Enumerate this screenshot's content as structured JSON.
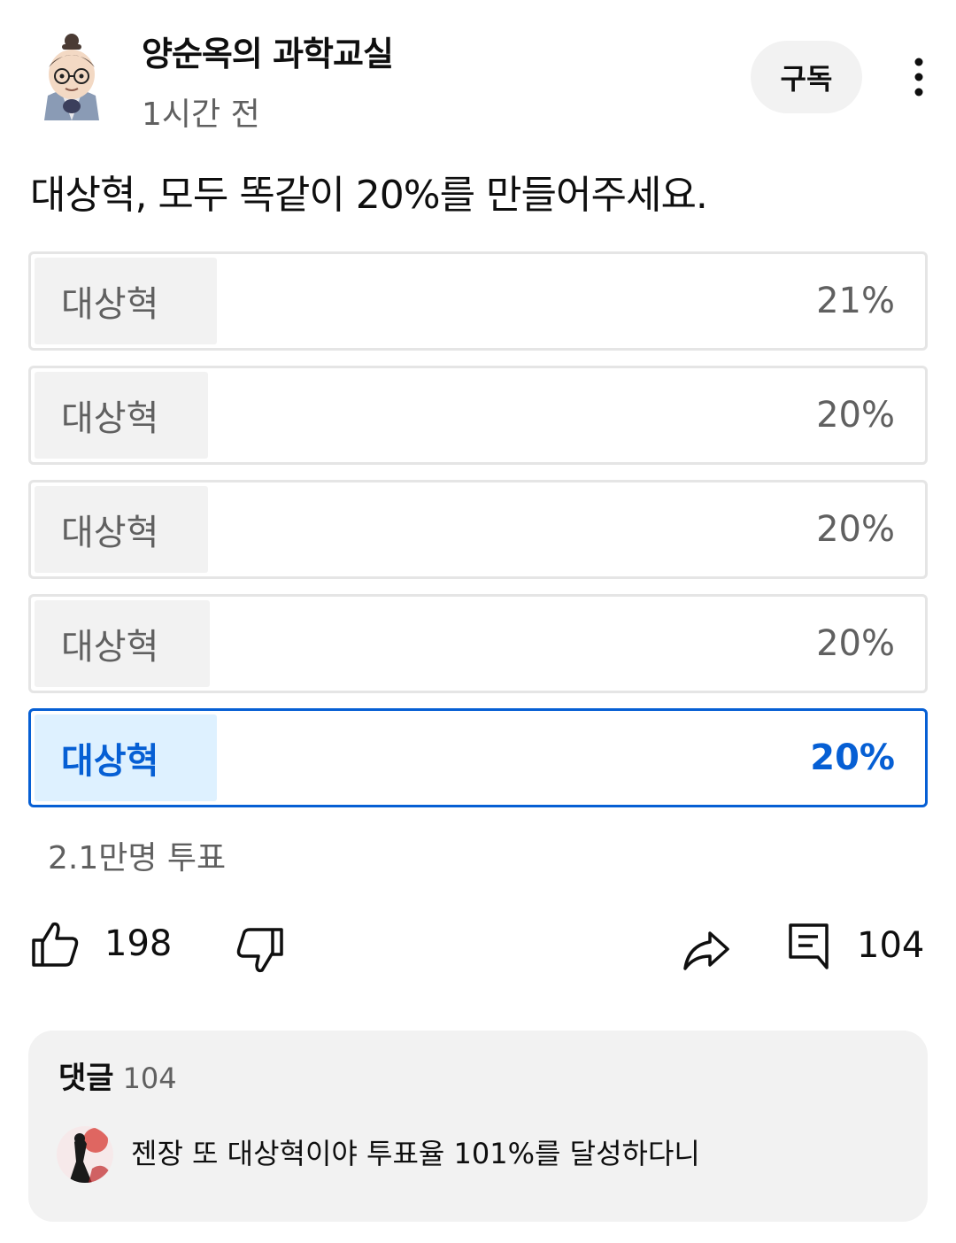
{
  "header": {
    "channel_name": "양순옥의 과학교실",
    "time": "1시간 전",
    "subscribe_label": "구독",
    "more_icon": "more-vert-icon"
  },
  "post": {
    "text": "대상혁, 모두 똑같이 20%를 만들어주세요."
  },
  "poll": {
    "options": [
      {
        "label": "대상혁",
        "percent": "21%",
        "value": 21,
        "selected": false
      },
      {
        "label": "대상혁",
        "percent": "20%",
        "value": 20,
        "selected": false
      },
      {
        "label": "대상혁",
        "percent": "20%",
        "value": 20,
        "selected": false
      },
      {
        "label": "대상혁",
        "percent": "20%",
        "value": 20,
        "selected": false
      },
      {
        "label": "대상혁",
        "percent": "20%",
        "value": 20,
        "selected": true
      }
    ],
    "vote_count": "2.1만명 투표"
  },
  "actions": {
    "like_count": "198",
    "comment_count": "104",
    "icons": [
      "thumb-up-icon",
      "thumb-down-icon",
      "share-icon",
      "comment-icon"
    ]
  },
  "comments": {
    "title": "댓글",
    "count": "104",
    "top_comment": "젠장 또 대상혁이야 투표율 101%를 달성하다니"
  },
  "colors": {
    "accent": "#065fd4",
    "selected_fill": "#def1ff",
    "option_fill": "#f2f2f2",
    "option_border": "#e5e5e5",
    "secondary_text": "#606060"
  }
}
